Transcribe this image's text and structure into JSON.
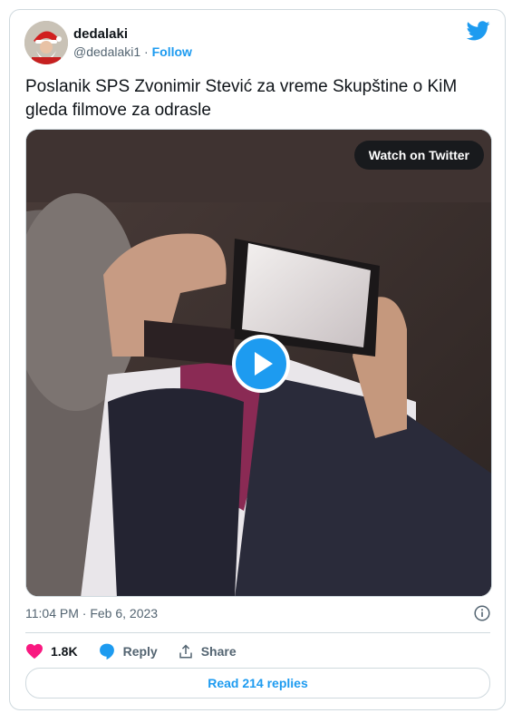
{
  "user": {
    "display_name": "dedalaki",
    "handle": "@dedalaki1",
    "separator": "·",
    "follow_label": "Follow"
  },
  "tweet": {
    "text": "Poslanik SPS Zvonimir Stević za vreme Skupštine o KiM gleda filmove za odrasle",
    "timestamp": "11:04 PM · Feb 6, 2023"
  },
  "media": {
    "watch_label": "Watch on Twitter"
  },
  "actions": {
    "likes": "1.8K",
    "reply_label": "Reply",
    "share_label": "Share"
  },
  "replies_button": "Read 214 replies",
  "colors": {
    "accent": "#1d9bf0",
    "like": "#f91880",
    "text": "#0f1419",
    "muted": "#536471",
    "border": "#cfd9de"
  }
}
